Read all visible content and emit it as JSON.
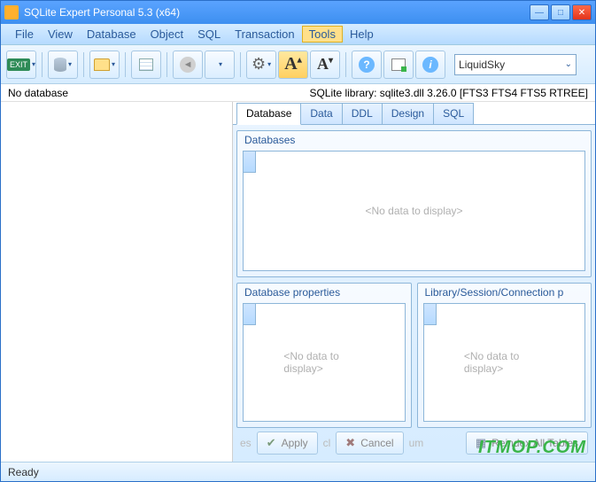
{
  "title": "SQLite Expert Personal 5.3 (x64)",
  "menu": [
    "File",
    "View",
    "Database",
    "Object",
    "SQL",
    "Transaction",
    "Tools",
    "Help"
  ],
  "menu_highlight": "Tools",
  "toolbar_select": "LiquidSky",
  "info_left": "No database",
  "info_right": "SQLite library: sqlite3.dll 3.26.0 [FTS3 FTS4 FTS5 RTREE]",
  "tabs": [
    "Database",
    "Data",
    "DDL",
    "Design",
    "SQL"
  ],
  "active_tab": "Database",
  "panels": {
    "databases": {
      "title": "Databases",
      "empty": "<No data to display>"
    },
    "props": {
      "title": "Database properties",
      "empty": "<No data to display>"
    },
    "session": {
      "title": "Library/Session/Connection p",
      "empty": "<No data to display>"
    }
  },
  "actions": {
    "frag_left": "es",
    "apply": "Apply",
    "frag_mid1": "cl",
    "cancel": "Cancel",
    "frag_mid2": "um",
    "reindex": "Reindex All Tables"
  },
  "status": "Ready",
  "watermark": "ITMOP.COM"
}
